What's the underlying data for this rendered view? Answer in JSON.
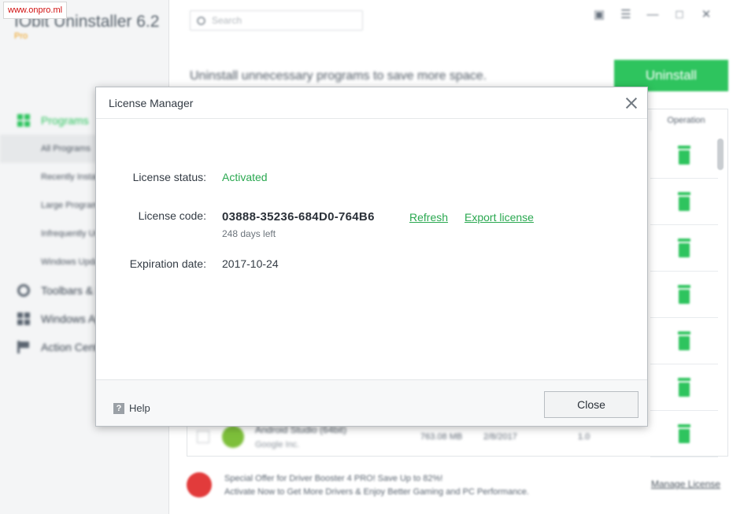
{
  "watermark": "www.onpro.ml",
  "app": {
    "title": "IObit Uninstaller 6.2",
    "edition": "Pro",
    "search_placeholder": "Search",
    "headline": "Uninstall unnecessary programs to save more space.",
    "uninstall_label": "Uninstall",
    "operation_header": "Operation",
    "nav": [
      {
        "label": "Programs",
        "icon": "grid-icon"
      },
      {
        "label": "Toolbars & Plugins",
        "icon": "toolbar-icon"
      },
      {
        "label": "Windows Apps",
        "icon": "windows-icon"
      },
      {
        "label": "Action Center",
        "icon": "flag-icon"
      }
    ],
    "sub_nav": [
      "All Programs",
      "Recently Installed",
      "Large Programs",
      "Infrequently Used",
      "Windows Updates"
    ],
    "visible_row": {
      "name": "Android Studio (64bit)",
      "publisher": "Google Inc.",
      "size": "763.08 MB",
      "date": "2/8/2017",
      "version": "1.0"
    },
    "promo": {
      "line1": "Special Offer for Driver Booster 4 PRO! Save Up to 82%!",
      "line2": "Activate Now to Get More Drivers & Enjoy Better Gaming and PC Performance.",
      "link": "Manage License"
    }
  },
  "dialog": {
    "title": "License Manager",
    "status_label": "License status:",
    "status_value": "Activated",
    "code_label": "License code:",
    "code_value": "03888-35236-684D0-764B6",
    "refresh_label": "Refresh",
    "export_label": "Export license",
    "days_left": "248 days left",
    "expiration_label": "Expiration date:",
    "expiration_value": "2017-10-24",
    "help_label": "Help",
    "help_icon_glyph": "?",
    "close_label": "Close"
  },
  "colors": {
    "accent_green": "#2ec45e",
    "link_green": "#2aa850",
    "promo_red": "#e23b3b",
    "watermark_red": "#d10f0f"
  }
}
